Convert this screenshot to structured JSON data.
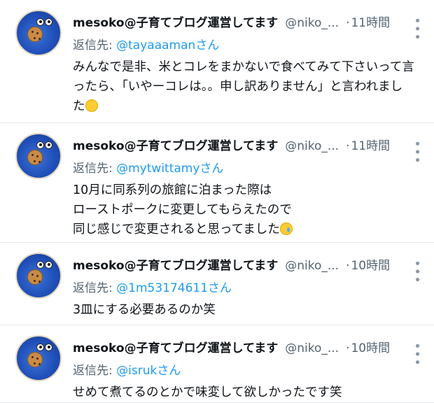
{
  "tweets": [
    {
      "name": "mesoko@子育てブログ運営してます",
      "handle": "@niko_...",
      "dot": "·",
      "time": "11時間",
      "reply_prefix": "返信先: ",
      "reply_to": "@tayaaamanさん",
      "lines": [
        "みんなで是非、米とコレをまかないで食べてみて下さいって言",
        "ったら、「いやーコレは。。申し訳ありません」と言われまし",
        "た"
      ],
      "emoji": "laughing-face-with-tears"
    },
    {
      "name": "mesoko@子育てブログ運営してます",
      "handle": "@niko_...",
      "dot": "·",
      "time": "11時間",
      "reply_prefix": "返信先: ",
      "reply_to": "@mytwittamyさん",
      "lines": [
        "10月に同系列の旅館に泊まった際は",
        "ローストポークに変更してもらえたので",
        "同じ感じで変更されると思ってました"
      ],
      "emoji": "crying-face"
    },
    {
      "name": "mesoko@子育てブログ運営してます",
      "handle": "@niko_...",
      "dot": "·",
      "time": "10時間",
      "reply_prefix": "返信先: ",
      "reply_to": "@1m53174611さん",
      "lines": [
        "3皿にする必要あるのか笑"
      ]
    },
    {
      "name": "mesoko@子育てブログ運営してます",
      "handle": "@niko_...",
      "dot": "·",
      "time": "10時間",
      "reply_prefix": "返信先: ",
      "reply_to": "@isrukさん",
      "lines": [
        "せめて煮てるのとかで味変して欲しかったです笑"
      ]
    }
  ],
  "icons": {
    "more": "more-vertical-icon",
    "avatar": "cookie-monster-avatar"
  },
  "colors": {
    "link": "#1d9bf0",
    "muted": "#536471",
    "divider": "#e6e9ec"
  }
}
